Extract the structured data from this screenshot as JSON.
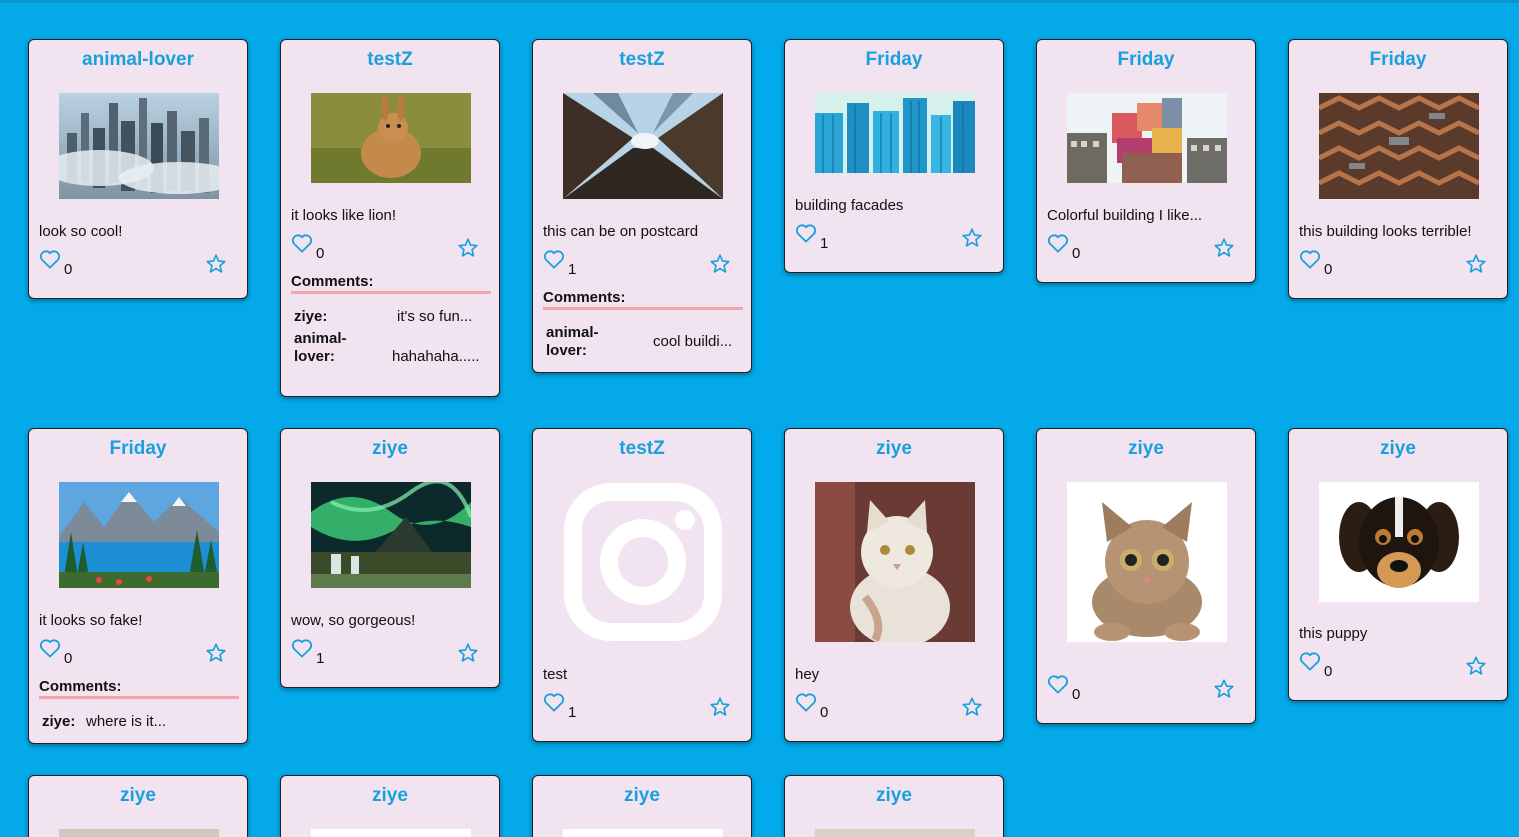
{
  "colors": {
    "background": "#03a9e9",
    "card": "#f1e3f0",
    "accent": "#1aa0dc",
    "rule": "#f3a5a9"
  },
  "icons": {
    "like": "heart-outline-icon",
    "favorite": "star-outline-icon"
  },
  "posts": [
    {
      "author": "animal-lover",
      "caption": "look so cool!",
      "likes": "0",
      "comments": []
    },
    {
      "author": "testZ",
      "caption": "it looks like lion!",
      "likes": "0",
      "comments_title": "Comments:",
      "comments": [
        {
          "user": "ziye:",
          "text": "it's so fun..."
        },
        {
          "user": "animal-lover:",
          "text": "hahahaha....."
        }
      ]
    },
    {
      "author": "testZ",
      "caption": "this can be on postcard",
      "likes": "1",
      "comments_title": "Comments:",
      "comments": [
        {
          "user": "animal-lover:",
          "text": "cool buildi..."
        }
      ]
    },
    {
      "author": "Friday",
      "caption": "building facades",
      "likes": "1",
      "comments": []
    },
    {
      "author": "Friday",
      "caption": "Colorful building I like...",
      "likes": "0",
      "comments": []
    },
    {
      "author": "Friday",
      "caption": "this building looks terrible!",
      "likes": "0",
      "comments": []
    },
    {
      "author": "Friday",
      "caption": "it looks so fake!",
      "likes": "0",
      "comments_title": "Comments:",
      "comments": [
        {
          "user": "ziye:",
          "text": "where is it..."
        }
      ]
    },
    {
      "author": "ziye",
      "caption": "wow, so gorgeous!",
      "likes": "1",
      "comments": []
    },
    {
      "author": "testZ",
      "caption": "test",
      "likes": "1",
      "comments": []
    },
    {
      "author": "ziye",
      "caption": "hey",
      "likes": "0",
      "comments": []
    },
    {
      "author": "ziye",
      "caption": "",
      "likes": "0",
      "comments": []
    },
    {
      "author": "ziye",
      "caption": "this puppy",
      "likes": "0",
      "comments": []
    },
    {
      "author": "ziye",
      "caption": "",
      "likes": "",
      "comments": []
    },
    {
      "author": "ziye",
      "caption": "",
      "likes": "",
      "comments": []
    },
    {
      "author": "ziye",
      "caption": "",
      "likes": "",
      "comments": []
    },
    {
      "author": "ziye",
      "caption": "",
      "likes": "",
      "comments": []
    }
  ]
}
